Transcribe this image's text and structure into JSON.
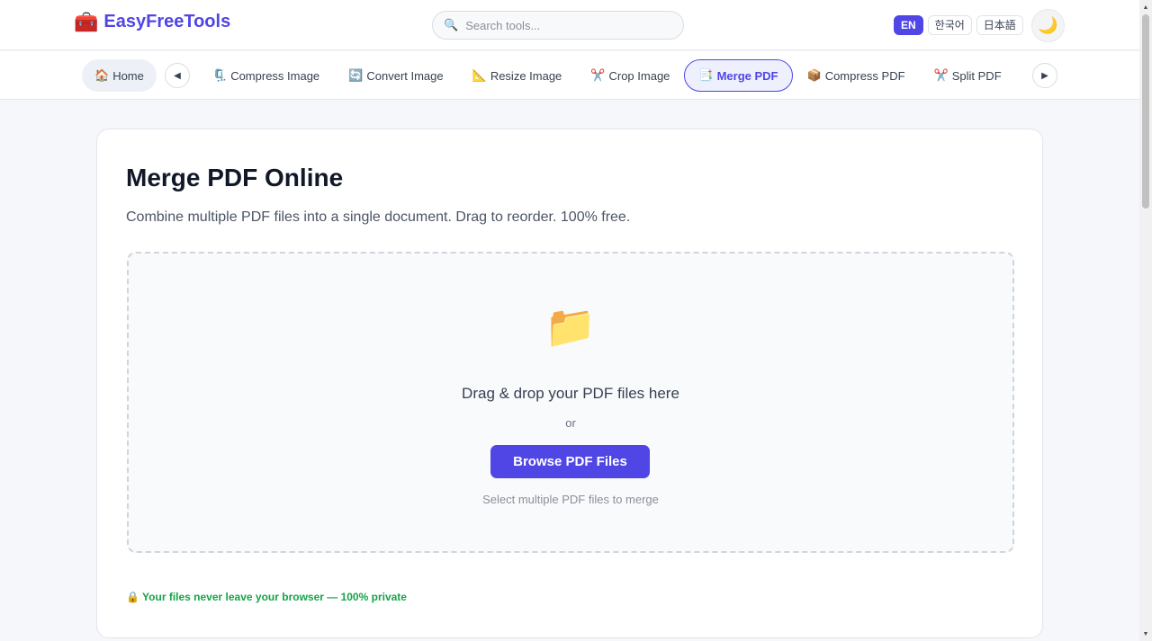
{
  "header": {
    "logo": {
      "icon": "🧰",
      "text": "EasyFreeTools"
    },
    "search": {
      "icon": "🔍",
      "placeholder": "Search tools..."
    },
    "languages": [
      {
        "code": "EN",
        "active": true
      },
      {
        "code": "한국어",
        "active": false
      },
      {
        "code": "日本語",
        "active": false
      }
    ],
    "theme_icon": "🌙"
  },
  "nav": {
    "home": {
      "icon": "🏠",
      "label": "Home"
    },
    "prev_arrow": "◀",
    "next_arrow": "▶",
    "items": [
      {
        "icon": "🗜️",
        "label": "Compress Image",
        "active": false
      },
      {
        "icon": "🔄",
        "label": "Convert Image",
        "active": false
      },
      {
        "icon": "📐",
        "label": "Resize Image",
        "active": false
      },
      {
        "icon": "✂️",
        "label": "Crop Image",
        "active": false
      },
      {
        "icon": "📑",
        "label": "Merge PDF",
        "active": true
      },
      {
        "icon": "📦",
        "label": "Compress PDF",
        "active": false
      },
      {
        "icon": "✂️",
        "label": "Split PDF",
        "active": false
      },
      {
        "icon": "📄",
        "label": "",
        "active": false
      }
    ]
  },
  "main": {
    "title": "Merge PDF Online",
    "description": "Combine multiple PDF files into a single document. Drag to reorder. 100% free.",
    "dropzone": {
      "icon": "📁",
      "title": "Drag & drop your PDF files here",
      "or": "or",
      "button": "Browse PDF Files",
      "hint": "Select multiple PDF files to merge"
    },
    "privacy": "🔒 Your files never leave your browser — 100% private"
  },
  "colors": {
    "accent": "#4f46e5",
    "privacy": "#16a34a"
  }
}
